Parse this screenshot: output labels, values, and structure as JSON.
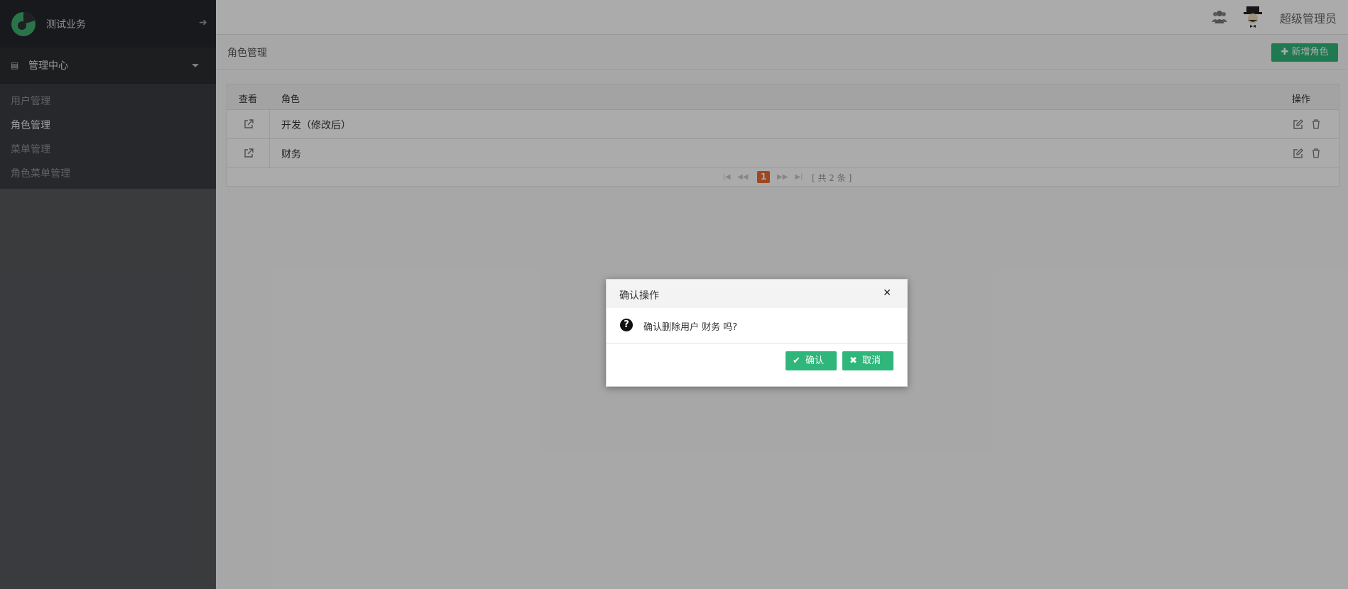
{
  "app": {
    "name": "测试业务"
  },
  "sidebar": {
    "group_label": "管理中心",
    "items": [
      {
        "label": "用户管理",
        "active": false
      },
      {
        "label": "角色管理",
        "active": true
      },
      {
        "label": "菜单管理",
        "active": false
      },
      {
        "label": "角色菜单管理",
        "active": false
      }
    ]
  },
  "header": {
    "user_name": "超级管理员"
  },
  "page": {
    "title": "角色管理",
    "add_button": "新增角色"
  },
  "table": {
    "columns": [
      "查看",
      "角色",
      "操作"
    ],
    "rows": [
      {
        "role": "开发（修改后）"
      },
      {
        "role": "财务"
      }
    ]
  },
  "pagination": {
    "current": "1",
    "total_text": "[ 共 2 条 ]"
  },
  "modal": {
    "title": "确认操作",
    "message": "确认删除用户 财务 吗?",
    "confirm_label": "确认",
    "cancel_label": "取消"
  },
  "colors": {
    "accent": "#2fb67a",
    "current_page": "#ee6a2e",
    "sidebar": "#2d3035"
  },
  "icons": [
    "logo-icon",
    "arrow-right-icon",
    "server-icon",
    "users-icon",
    "avatar-icon",
    "plus-icon",
    "external-link-icon",
    "edit-icon",
    "trash-icon",
    "question-circle-icon",
    "close-icon",
    "check-icon",
    "times-icon"
  ]
}
